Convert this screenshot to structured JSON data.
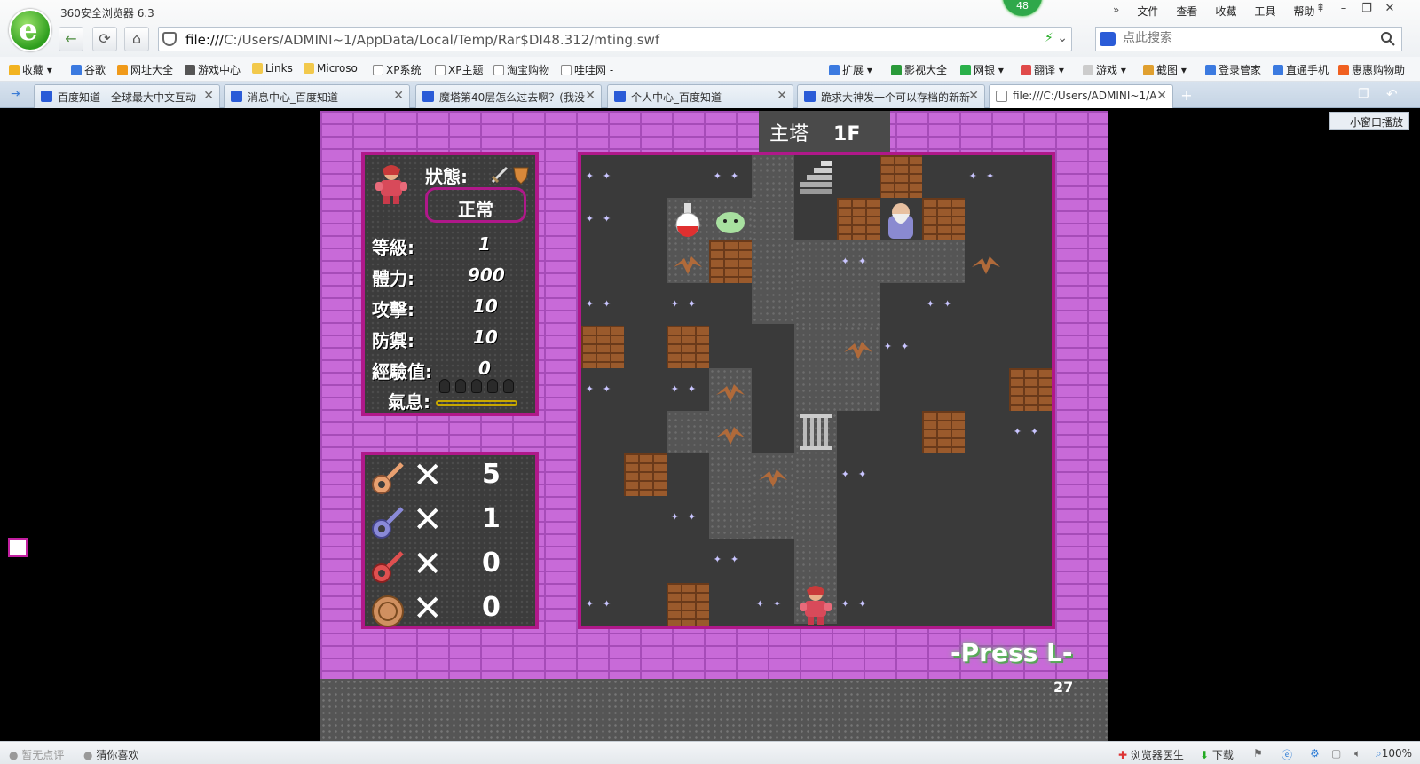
{
  "window": {
    "title": "360安全浏览器 6.3",
    "badge": "48",
    "menu": [
      "»",
      "文件",
      "查看",
      "收藏",
      "工具",
      "帮助"
    ],
    "controls": [
      "⇞",
      "–",
      "❐",
      "✕"
    ]
  },
  "nav": {
    "url_prefix": "file:///",
    "url_path": "C:/Users/ADMINI~1/AppData/Local/Temp/Rar$DI48.312/mting.swf",
    "search_placeholder": "点此搜索"
  },
  "bookmarks": {
    "left": [
      {
        "label": "收藏",
        "color": "#f2b321"
      },
      {
        "label": "谷歌",
        "color": "#3b7ae0"
      },
      {
        "label": "网址大全",
        "color": "#f09a1a"
      },
      {
        "label": "游戏中心",
        "color": "#555555"
      },
      {
        "label": "Links",
        "color": "#f2c94c"
      },
      {
        "label": "Microso",
        "color": "#f2c94c"
      },
      {
        "label": "XP系统",
        "color": "#cccccc"
      },
      {
        "label": "XP主题",
        "color": "#cccccc"
      },
      {
        "label": "淘宝购物",
        "color": "#cccccc"
      },
      {
        "label": "哇哇网 -",
        "color": "#cccccc"
      }
    ],
    "right": [
      {
        "label": "扩展",
        "color": "#3b7ae0"
      },
      {
        "label": "影视大全",
        "color": "#2a9a3a"
      },
      {
        "label": "网银",
        "color": "#2ab04a"
      },
      {
        "label": "翻译",
        "color": "#e04a4a"
      },
      {
        "label": "游戏",
        "color": "#cccccc"
      },
      {
        "label": "截图",
        "color": "#e0a030"
      },
      {
        "label": "登录管家",
        "color": "#3b7ae0"
      },
      {
        "label": "直通手机",
        "color": "#3b7ae0"
      },
      {
        "label": "惠惠购物助",
        "color": "#f06020"
      }
    ]
  },
  "tabs": [
    {
      "label": "百度知道 - 全球最大中文互动"
    },
    {
      "label": "消息中心_百度知道"
    },
    {
      "label": "魔塔第40层怎么过去啊？(我没"
    },
    {
      "label": "个人中心_百度知道"
    },
    {
      "label": "跪求大神发一个可以存档的新新"
    },
    {
      "label": "file:///C:/Users/ADMINI~1/A",
      "active": true
    }
  ],
  "mini_window": "小窗口播放",
  "game": {
    "tower": "主塔",
    "floor": "1F",
    "status_label": "狀態:",
    "status_value": "正常",
    "stats": [
      {
        "label": "等級:",
        "value": "1"
      },
      {
        "label": "體力:",
        "value": "900"
      },
      {
        "label": "攻擊:",
        "value": "10"
      },
      {
        "label": "防禦:",
        "value": "10"
      },
      {
        "label": "經驗值:",
        "value": "0"
      }
    ],
    "aura_label": "氣息:",
    "keys": [
      {
        "name": "yellow-key",
        "color": "#e8a070",
        "count": "5"
      },
      {
        "name": "blue-key",
        "color": "#8a8ad8",
        "count": "1"
      },
      {
        "name": "red-key",
        "color": "#e05050",
        "count": "0"
      },
      {
        "name": "coin",
        "color": "#d09060",
        "count": "0"
      }
    ],
    "key_x": "✕",
    "press_hint": "-Press L-",
    "counter": "27"
  },
  "statusbar": {
    "left": [
      "暂无点评",
      "猜你喜欢"
    ],
    "right": [
      "浏览器医生",
      "下载",
      "100%"
    ]
  }
}
